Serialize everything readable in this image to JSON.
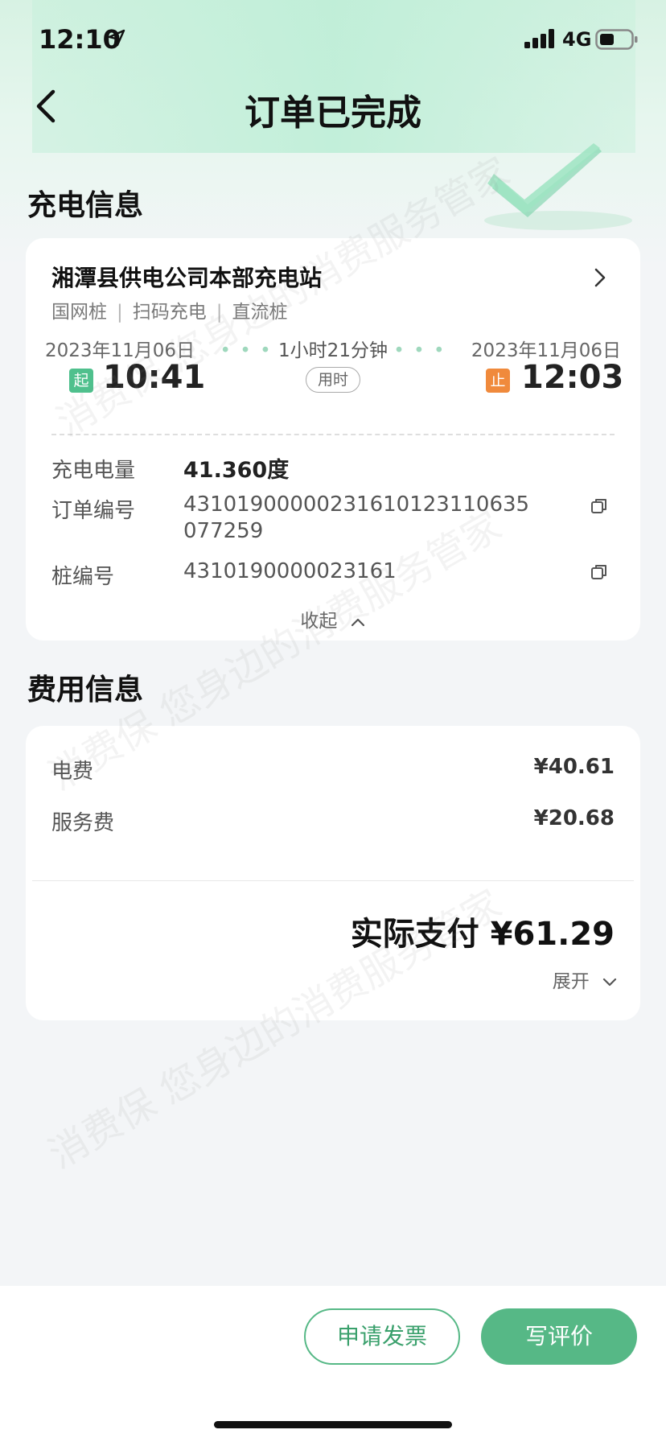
{
  "status_bar": {
    "time": "12:10",
    "network": "4G"
  },
  "nav": {
    "title": "订单已完成"
  },
  "charging_section": {
    "title": "充电信息",
    "station_name": "湘潭县供电公司本部充电站",
    "tags": [
      "国网桩",
      "扫码充电",
      "直流桩"
    ],
    "tag_separator": "|",
    "start": {
      "date": "2023年11月06日",
      "badge": "起",
      "time": "10:41"
    },
    "end": {
      "date": "2023年11月06日",
      "badge": "止",
      "time": "12:03"
    },
    "duration": {
      "text": "1小时21分钟",
      "label": "用时",
      "dots": "• • •"
    },
    "details": [
      {
        "label": "充电电量",
        "value": "41.360度"
      },
      {
        "label": "订单编号",
        "value": "43101900000231610123110635077259"
      },
      {
        "label": "桩编号",
        "value": "4310190000023161"
      }
    ],
    "collapse_label": "收起"
  },
  "fee_section": {
    "title": "费用信息",
    "items": [
      {
        "label": "电费",
        "value": "¥40.61"
      },
      {
        "label": "服务费",
        "value": "¥20.68"
      }
    ],
    "total": "实际支付 ¥61.29",
    "expand_label": "展开"
  },
  "actions": {
    "invoice_label": "申请发票",
    "review_label": "写评价"
  },
  "watermark": {
    "text": "消费保 您身边的消费服务管家"
  },
  "colors": {
    "accent": "#56b886",
    "start_badge": "#4fc08d",
    "end_badge": "#f08a3c"
  },
  "icons": [
    "location-arrow-icon",
    "signal-icon",
    "battery-icon",
    "back-icon",
    "chevron-right-icon",
    "copy-icon",
    "chevron-up-icon",
    "chevron-down-icon",
    "checkmark-decoration-icon"
  ]
}
